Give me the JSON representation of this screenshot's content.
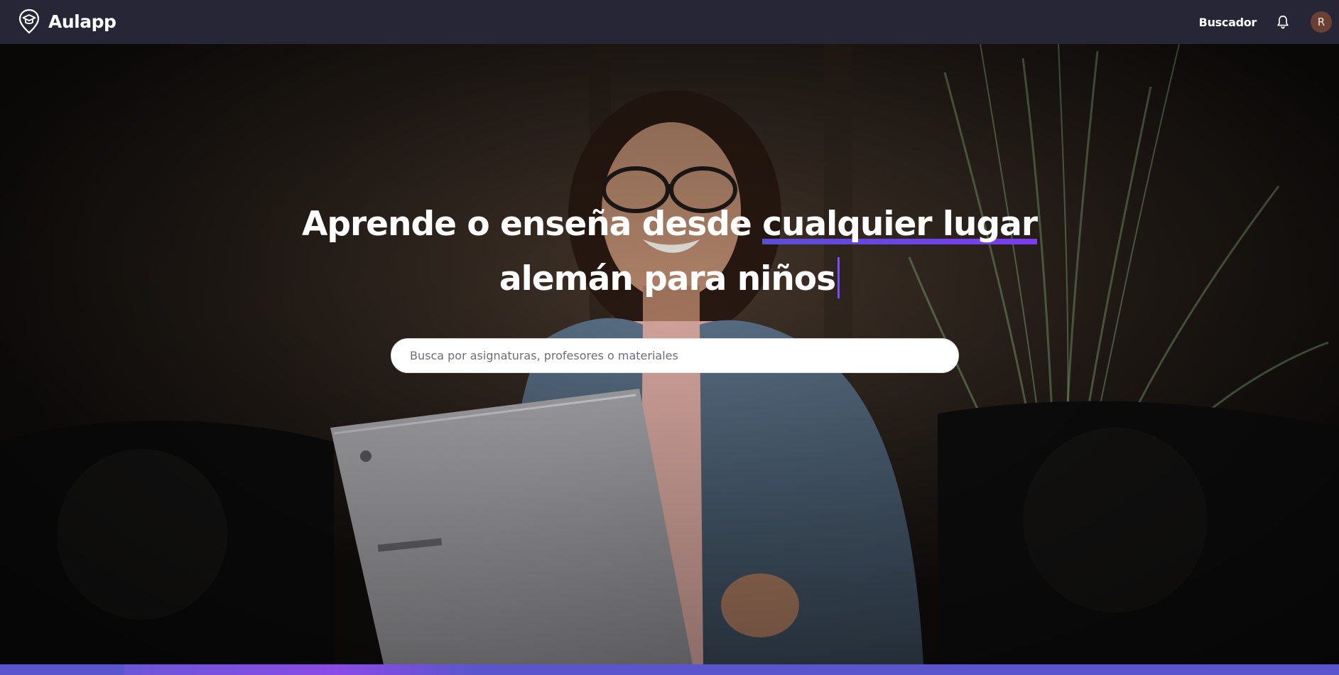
{
  "navbar": {
    "brand_name": "Aulapp",
    "search_link_label": "Buscador",
    "avatar_initial": "R"
  },
  "hero": {
    "headline_prefix": "Aprende o enseña desde",
    "headline_highlight": "cualquier lugar",
    "typed_text": "alemán para niños",
    "search_placeholder": "Busca por asignaturas, profesores o materiales"
  },
  "colors": {
    "navbar_bg": "#272636",
    "accent": "#7b3df0",
    "accent_blue": "#5a55cc"
  },
  "icons": {
    "logo": "graduation-cap-pin-icon",
    "notifications": "bell-icon"
  }
}
